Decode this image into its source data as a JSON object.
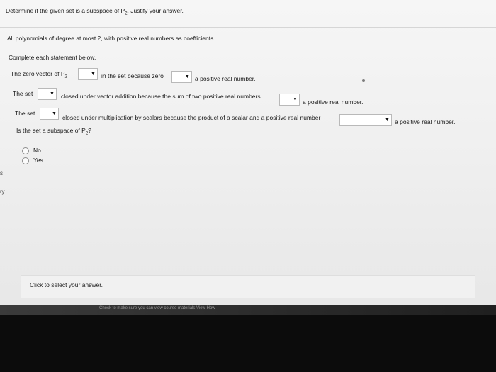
{
  "question": {
    "title_pre": "Determine if the given set is a subspace of P",
    "title_sub": "2",
    "title_post": ". Justify your answer."
  },
  "set_description": "All polynomials of degree at most 2, with positive real numbers as coefficients.",
  "instructions": "Complete each statement below.",
  "statement1": {
    "pre": "The zero vector of P",
    "sub": "2",
    "mid": "in the set because zero",
    "post": "a positive real number."
  },
  "statement2": {
    "pre": "The set",
    "mid": "closed under vector addition because the sum of two positive real numbers",
    "post": "a positive real number."
  },
  "statement3": {
    "pre": "The set",
    "mid": "closed under multiplication by scalars because the product of a scalar and a positive real number",
    "post": "a positive real number."
  },
  "subspace_question": {
    "pre": "Is the set a subspace of P",
    "sub": "2",
    "post": "?"
  },
  "options": [
    "No",
    "Yes"
  ],
  "status": "Click to select your answer.",
  "edge_glyphs": [
    "s",
    "ry"
  ],
  "dropdown_arrow": "▼",
  "taskbar_text": "Check to make sure you can view course materials  View How"
}
